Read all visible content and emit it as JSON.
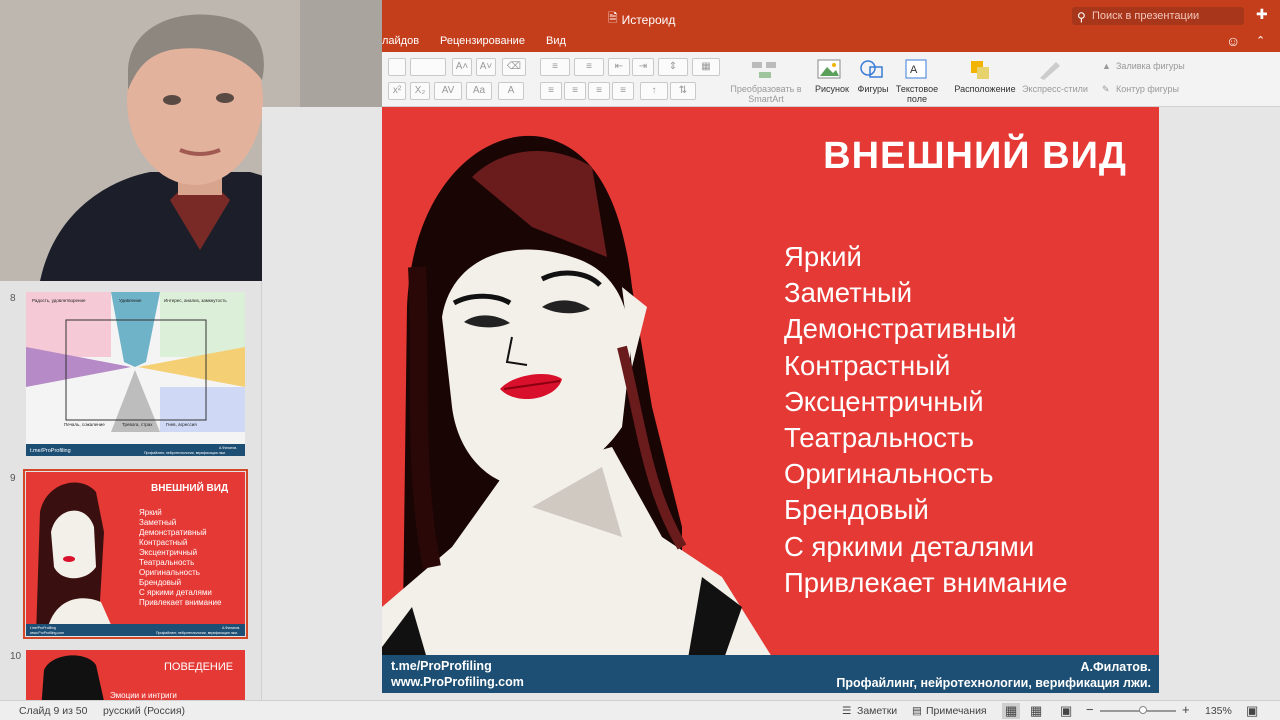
{
  "window": {
    "title": "Истероид",
    "search_placeholder": "Поиск в презентации"
  },
  "tabs": [
    "лайдов",
    "Рецензирование",
    "Вид"
  ],
  "ribbon": {
    "smartart_label": "Преобразовать в SmartArt",
    "picture_label": "Рисунок",
    "shapes_label": "Фигуры",
    "textbox_label": "Текстовое поле",
    "arrange_label": "Расположение",
    "quickstyles_label": "Экспресс-стили",
    "fill_label": "Заливка фигуры",
    "outline_label": "Контур фигуры"
  },
  "thumbnails": {
    "numbers": [
      "8",
      "9",
      "10"
    ],
    "slide8": {
      "labels_top": [
        "Радость, удовлетворение",
        "Удивление",
        "Интерес, анализ, замкнутость"
      ],
      "labels_bottom": [
        "Печаль, сожаление",
        "Тревога, страх",
        "Гнев, агрессия"
      ],
      "footer_left": "t.me/ProProfiling",
      "footer_right_top": "А.Филатов.",
      "footer_right_bottom": "Профайлинг, нейротехнологии, верификация лжи."
    },
    "slide9": {
      "title": "ВНЕШНИЙ ВИД",
      "footer_left_top": "t.me/ProProfiling",
      "footer_left_bottom": "www.ProProfiling.com",
      "footer_right_top": "А.Филатов.",
      "footer_right_bottom": "Профайлинг, нейротехнологии, верификация лжи."
    },
    "slide10": {
      "title": "ПОВЕДЕНИЕ",
      "item": "Эмоции и интриги"
    }
  },
  "slide": {
    "title": "ВНЕШНИЙ ВИД",
    "items": [
      "Яркий",
      "Заметный",
      "Демонстративный",
      "Контрастный",
      "Эксцентричный",
      "Театральность",
      "Оригинальность",
      "Брендовый",
      "С яркими деталями",
      "Привлекает внимание"
    ],
    "footer": {
      "left_top": "t.me/ProProfiling",
      "left_bottom": "www.ProProfiling.com",
      "right_top": "А.Филатов.",
      "right_bottom": "Профайлинг, нейротехнологии, верификация лжи."
    }
  },
  "status": {
    "slide_of": "Слайд 9 из 50",
    "language": "русский (Россия)",
    "notes": "Заметки",
    "comments": "Примечания",
    "zoom": "135%"
  },
  "colors": {
    "accent": "#c43e1c",
    "slide_bg": "#e53935",
    "footer_bg": "#1d4e73"
  }
}
